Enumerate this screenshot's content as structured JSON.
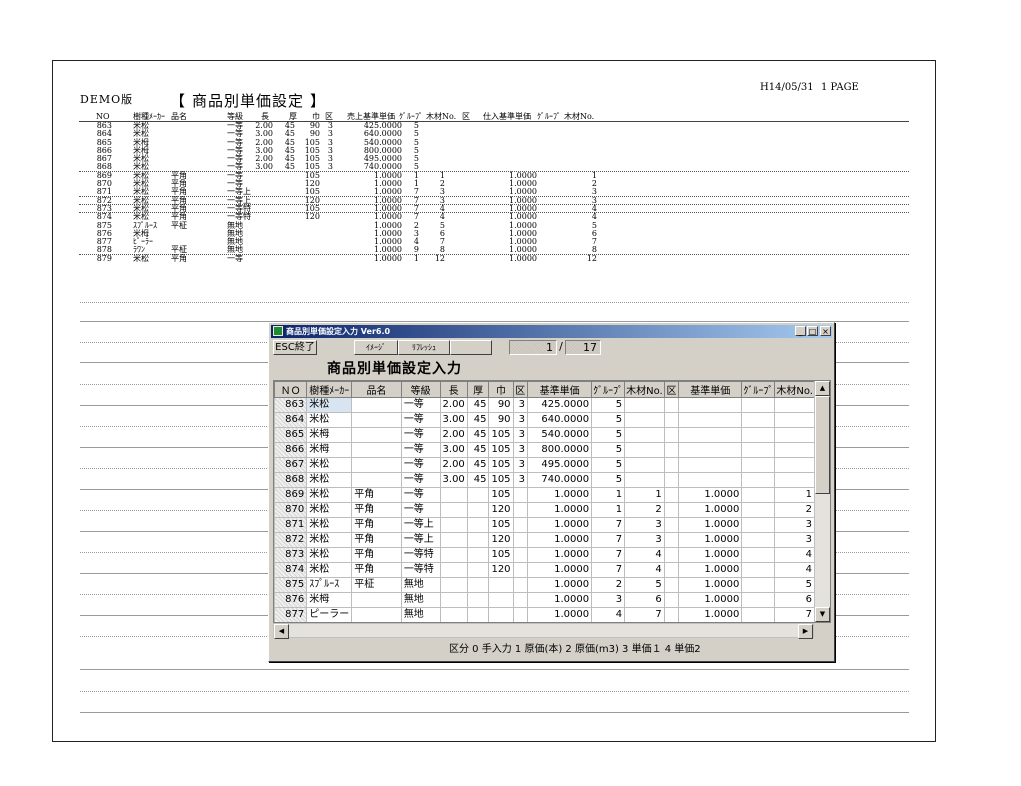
{
  "report": {
    "date": "H14/05/31",
    "page": "1 PAGE",
    "demo": "DEMO版",
    "title_bracket_left": "【",
    "title": "商品別単価設定",
    "title_bracket_right": "】",
    "headers": {
      "no": "NO",
      "maker": "樹種ﾒｰｶｰ",
      "name": "品名",
      "grade": "等級",
      "length": "長",
      "thick": "厚",
      "width": "巾",
      "ku": "区",
      "sale_price": "売上基準単価",
      "sale_group": "ｸﾞﾙｰﾌﾟ",
      "sale_wood": "木材No.",
      "ku2": "区",
      "buy_price": "仕入基準単価",
      "buy_group": "ｸﾞﾙｰﾌﾟ",
      "buy_wood": "木材No."
    },
    "rows": [
      {
        "no": "863",
        "maker": "米松",
        "name": "",
        "grade": "一等",
        "length": "2.00",
        "thick": "45",
        "width": "90",
        "ku": "3",
        "price": "425.0000",
        "group": "5",
        "wood": "",
        "ku2": "",
        "buy_price": "",
        "buy_group": "",
        "buy_wood": ""
      },
      {
        "no": "864",
        "maker": "米松",
        "name": "",
        "grade": "一等",
        "length": "3.00",
        "thick": "45",
        "width": "90",
        "ku": "3",
        "price": "640.0000",
        "group": "5",
        "wood": "",
        "ku2": "",
        "buy_price": "",
        "buy_group": "",
        "buy_wood": ""
      },
      {
        "no": "865",
        "maker": "米栂",
        "name": "",
        "grade": "一等",
        "length": "2.00",
        "thick": "45",
        "width": "105",
        "ku": "3",
        "price": "540.0000",
        "group": "5",
        "wood": "",
        "ku2": "",
        "buy_price": "",
        "buy_group": "",
        "buy_wood": ""
      },
      {
        "no": "866",
        "maker": "米栂",
        "name": "",
        "grade": "一等",
        "length": "3.00",
        "thick": "45",
        "width": "105",
        "ku": "3",
        "price": "800.0000",
        "group": "5",
        "wood": "",
        "ku2": "",
        "buy_price": "",
        "buy_group": "",
        "buy_wood": ""
      },
      {
        "no": "867",
        "maker": "米松",
        "name": "",
        "grade": "一等",
        "length": "2.00",
        "thick": "45",
        "width": "105",
        "ku": "3",
        "price": "495.0000",
        "group": "5",
        "wood": "",
        "ku2": "",
        "buy_price": "",
        "buy_group": "",
        "buy_wood": ""
      },
      {
        "no": "868",
        "maker": "米松",
        "name": "",
        "grade": "一等",
        "length": "3.00",
        "thick": "45",
        "width": "105",
        "ku": "3",
        "price": "740.0000",
        "group": "5",
        "wood": "",
        "ku2": "",
        "buy_price": "",
        "buy_group": "",
        "buy_wood": ""
      },
      {
        "no": "869",
        "maker": "米松",
        "name": "平角",
        "grade": "一等",
        "length": "",
        "thick": "",
        "width": "105",
        "ku": "",
        "price": "1.0000",
        "group": "1",
        "wood": "1",
        "ku2": "",
        "buy_price": "1.0000",
        "buy_group": "",
        "buy_wood": "1"
      },
      {
        "no": "870",
        "maker": "米松",
        "name": "平角",
        "grade": "一等",
        "length": "",
        "thick": "",
        "width": "120",
        "ku": "",
        "price": "1.0000",
        "group": "1",
        "wood": "2",
        "ku2": "",
        "buy_price": "1.0000",
        "buy_group": "",
        "buy_wood": "2"
      },
      {
        "no": "871",
        "maker": "米松",
        "name": "平角",
        "grade": "一等上",
        "length": "",
        "thick": "",
        "width": "105",
        "ku": "",
        "price": "1.0000",
        "group": "7",
        "wood": "3",
        "ku2": "",
        "buy_price": "1.0000",
        "buy_group": "",
        "buy_wood": "3"
      },
      {
        "no": "872",
        "maker": "米松",
        "name": "平角",
        "grade": "一等上",
        "length": "",
        "thick": "",
        "width": "120",
        "ku": "",
        "price": "1.0000",
        "group": "7",
        "wood": "3",
        "ku2": "",
        "buy_price": "1.0000",
        "buy_group": "",
        "buy_wood": "3"
      },
      {
        "no": "873",
        "maker": "米松",
        "name": "平角",
        "grade": "一等特",
        "length": "",
        "thick": "",
        "width": "105",
        "ku": "",
        "price": "1.0000",
        "group": "7",
        "wood": "4",
        "ku2": "",
        "buy_price": "1.0000",
        "buy_group": "",
        "buy_wood": "4"
      },
      {
        "no": "874",
        "maker": "米松",
        "name": "平角",
        "grade": "一等特",
        "length": "",
        "thick": "",
        "width": "120",
        "ku": "",
        "price": "1.0000",
        "group": "7",
        "wood": "4",
        "ku2": "",
        "buy_price": "1.0000",
        "buy_group": "",
        "buy_wood": "4"
      },
      {
        "no": "875",
        "maker": "ｽﾌﾟﾙｰｽ",
        "name": "平柾",
        "grade": "無地",
        "length": "",
        "thick": "",
        "width": "",
        "ku": "",
        "price": "1.0000",
        "group": "2",
        "wood": "5",
        "ku2": "",
        "buy_price": "1.0000",
        "buy_group": "",
        "buy_wood": "5"
      },
      {
        "no": "876",
        "maker": "米栂",
        "name": "",
        "grade": "無地",
        "length": "",
        "thick": "",
        "width": "",
        "ku": "",
        "price": "1.0000",
        "group": "3",
        "wood": "6",
        "ku2": "",
        "buy_price": "1.0000",
        "buy_group": "",
        "buy_wood": "6"
      },
      {
        "no": "877",
        "maker": "ﾋﾟｰﾗｰ",
        "name": "",
        "grade": "無地",
        "length": "",
        "thick": "",
        "width": "",
        "ku": "",
        "price": "1.0000",
        "group": "4",
        "wood": "7",
        "ku2": "",
        "buy_price": "1.0000",
        "buy_group": "",
        "buy_wood": "7"
      },
      {
        "no": "878",
        "maker": "ﾗﾜﾝ",
        "name": "平柾",
        "grade": "無地",
        "length": "",
        "thick": "",
        "width": "",
        "ku": "",
        "price": "1.0000",
        "group": "9",
        "wood": "8",
        "ku2": "",
        "buy_price": "1.0000",
        "buy_group": "",
        "buy_wood": "8"
      },
      {
        "no": "879",
        "maker": "米松",
        "name": "平角",
        "grade": "一等",
        "length": "",
        "thick": "",
        "width": "",
        "ku": "",
        "price": "1.0000",
        "group": "1",
        "wood": "12",
        "ku2": "",
        "buy_price": "1.0000",
        "buy_group": "",
        "buy_wood": "12"
      }
    ]
  },
  "window": {
    "title": "商品別単価設定入力 Ver6.0",
    "minimize": "_",
    "maximize": "□",
    "close": "×",
    "toolbar": {
      "esc": "ESC終了",
      "image": "ｲﾒｰｼﾞ",
      "refresh": "ﾘﾌﾚｯｼｭ",
      "extra": ""
    },
    "page_current": "1",
    "page_separator": "/",
    "page_total": "17",
    "heading": "商品別単価設定入力",
    "grid_headers": [
      "ＮＯ",
      "樹種ﾒｰｶｰ",
      "品名",
      "等級",
      "長",
      "厚",
      "巾",
      "区",
      "基準単価",
      "ｸﾞﾙｰﾌﾟ",
      "木材No.",
      "区",
      "基準単価",
      "ｸﾞﾙｰﾌﾟ",
      "木材No."
    ],
    "grid_rows": [
      [
        "863",
        "米松",
        "",
        "一等",
        "2.00",
        "45",
        "90",
        "3",
        "425.0000",
        "5",
        "",
        "",
        "",
        "",
        ""
      ],
      [
        "864",
        "米松",
        "",
        "一等",
        "3.00",
        "45",
        "90",
        "3",
        "640.0000",
        "5",
        "",
        "",
        "",
        "",
        ""
      ],
      [
        "865",
        "米栂",
        "",
        "一等",
        "2.00",
        "45",
        "105",
        "3",
        "540.0000",
        "5",
        "",
        "",
        "",
        "",
        ""
      ],
      [
        "866",
        "米栂",
        "",
        "一等",
        "3.00",
        "45",
        "105",
        "3",
        "800.0000",
        "5",
        "",
        "",
        "",
        "",
        ""
      ],
      [
        "867",
        "米松",
        "",
        "一等",
        "2.00",
        "45",
        "105",
        "3",
        "495.0000",
        "5",
        "",
        "",
        "",
        "",
        ""
      ],
      [
        "868",
        "米松",
        "",
        "一等",
        "3.00",
        "45",
        "105",
        "3",
        "740.0000",
        "5",
        "",
        "",
        "",
        "",
        ""
      ],
      [
        "869",
        "米松",
        "平角",
        "一等",
        "",
        "",
        "105",
        "",
        "1.0000",
        "1",
        "1",
        "",
        "1.0000",
        "",
        "1"
      ],
      [
        "870",
        "米松",
        "平角",
        "一等",
        "",
        "",
        "120",
        "",
        "1.0000",
        "1",
        "2",
        "",
        "1.0000",
        "",
        "2"
      ],
      [
        "871",
        "米松",
        "平角",
        "一等上",
        "",
        "",
        "105",
        "",
        "1.0000",
        "7",
        "3",
        "",
        "1.0000",
        "",
        "3"
      ],
      [
        "872",
        "米松",
        "平角",
        "一等上",
        "",
        "",
        "120",
        "",
        "1.0000",
        "7",
        "3",
        "",
        "1.0000",
        "",
        "3"
      ],
      [
        "873",
        "米松",
        "平角",
        "一等特",
        "",
        "",
        "105",
        "",
        "1.0000",
        "7",
        "4",
        "",
        "1.0000",
        "",
        "4"
      ],
      [
        "874",
        "米松",
        "平角",
        "一等特",
        "",
        "",
        "120",
        "",
        "1.0000",
        "7",
        "4",
        "",
        "1.0000",
        "",
        "4"
      ],
      [
        "875",
        "ｽﾌﾟﾙｰｽ",
        "平柾",
        "無地",
        "",
        "",
        "",
        "",
        "1.0000",
        "2",
        "5",
        "",
        "1.0000",
        "",
        "5"
      ],
      [
        "876",
        "米栂",
        "",
        "無地",
        "",
        "",
        "",
        "",
        "1.0000",
        "3",
        "6",
        "",
        "1.0000",
        "",
        "6"
      ],
      [
        "877",
        "ピーラー",
        "",
        "無地",
        "",
        "",
        "",
        "",
        "1.0000",
        "4",
        "7",
        "",
        "1.0000",
        "",
        "7"
      ]
    ],
    "scroll_up": "▲",
    "scroll_down": "▼",
    "scroll_left": "◀",
    "scroll_right": "▶",
    "status": "区分 0 手入力 1 原価(本) 2 原価(m3) 3 単価１ 4 単価2"
  }
}
